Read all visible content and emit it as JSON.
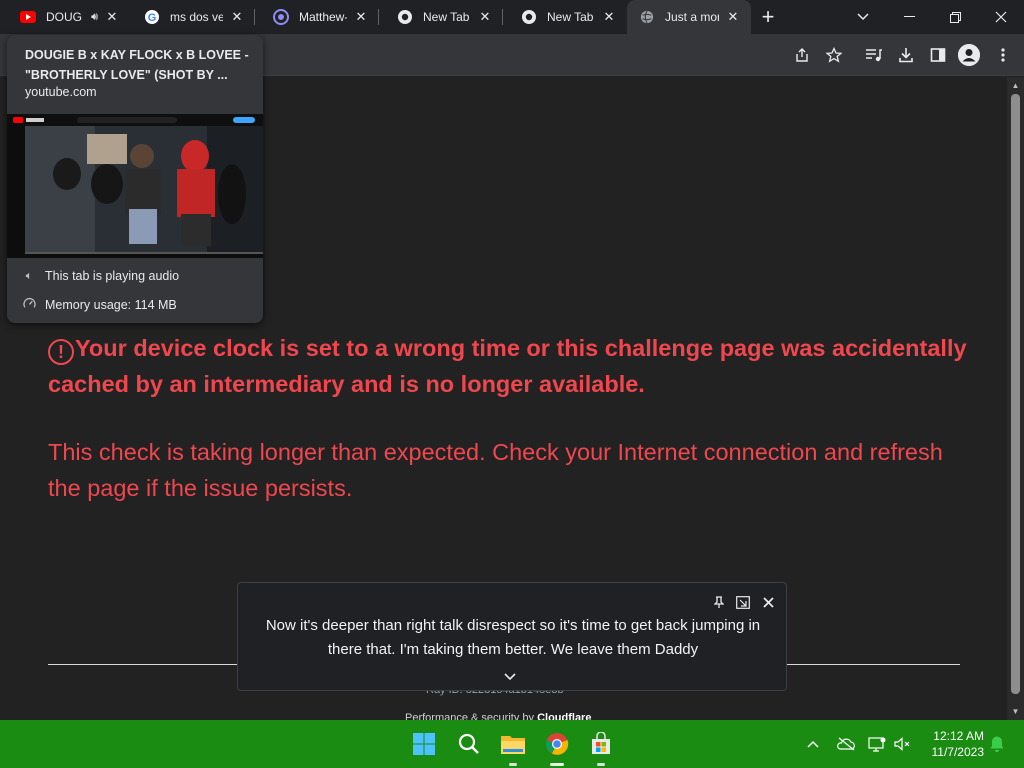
{
  "browser": {
    "tabs": [
      {
        "title": "DOUG",
        "favicon": "youtube-icon",
        "audio": true
      },
      {
        "title": "ms dos ver",
        "favicon": "google-icon"
      },
      {
        "title": "Matthew-",
        "favicon": "extension-icon"
      },
      {
        "title": "New Tab",
        "favicon": "chrome-icon"
      },
      {
        "title": "New Tab",
        "favicon": "chrome-icon"
      },
      {
        "title": "Just a mon",
        "favicon": "globe-icon",
        "active": true
      }
    ],
    "new_tab_label": "+",
    "window_controls": [
      "minimize-icon",
      "restore-icon",
      "close-icon"
    ]
  },
  "toolbar": {
    "icons": [
      "share-icon",
      "bookmark-star-icon",
      "media-queue-icon",
      "download-icon",
      "side-panel-icon",
      "profile-avatar-icon",
      "kebab-menu-icon"
    ]
  },
  "hover_card": {
    "title": "DOUGIE B x KAY FLOCK x B LOVEE - \"BROTHERLY LOVE\" (SHOT BY ...",
    "domain": "youtube.com",
    "audio_status": "This tab is playing audio",
    "memory_usage": "Memory usage: 114 MB"
  },
  "page": {
    "error_bold": "Your device clock is set to a wrong time or this challenge page was accidentally cached by an intermediary and is no longer available.",
    "error_normal": "This check is taking longer than expected. Check your Internet connection and refresh the page if the issue persists.",
    "ray_id": "Ray ID: 8223154a1b148e3b",
    "performance_prefix": "Performance & security by ",
    "performance_brand": "Cloudflare",
    "accent_color": "#f0474f"
  },
  "live_caption": {
    "text": "Now it's deeper than right talk disrespect so it's time to get back jumping in there that. I'm taking them better. We leave them Daddy",
    "buttons": [
      "pin-icon",
      "open-in-window-icon",
      "close-icon"
    ]
  },
  "taskbar": {
    "apps": [
      "windows-start-icon",
      "search-icon",
      "file-explorer-icon",
      "chrome-icon",
      "microsoft-store-icon"
    ],
    "tray_icons": [
      "chevron-up-icon",
      "onedrive-icon",
      "network-icon",
      "volume-muted-icon",
      "notification-bell-icon"
    ],
    "time": "12:12 AM",
    "date": "11/7/2023",
    "background": "#1a8c12"
  }
}
